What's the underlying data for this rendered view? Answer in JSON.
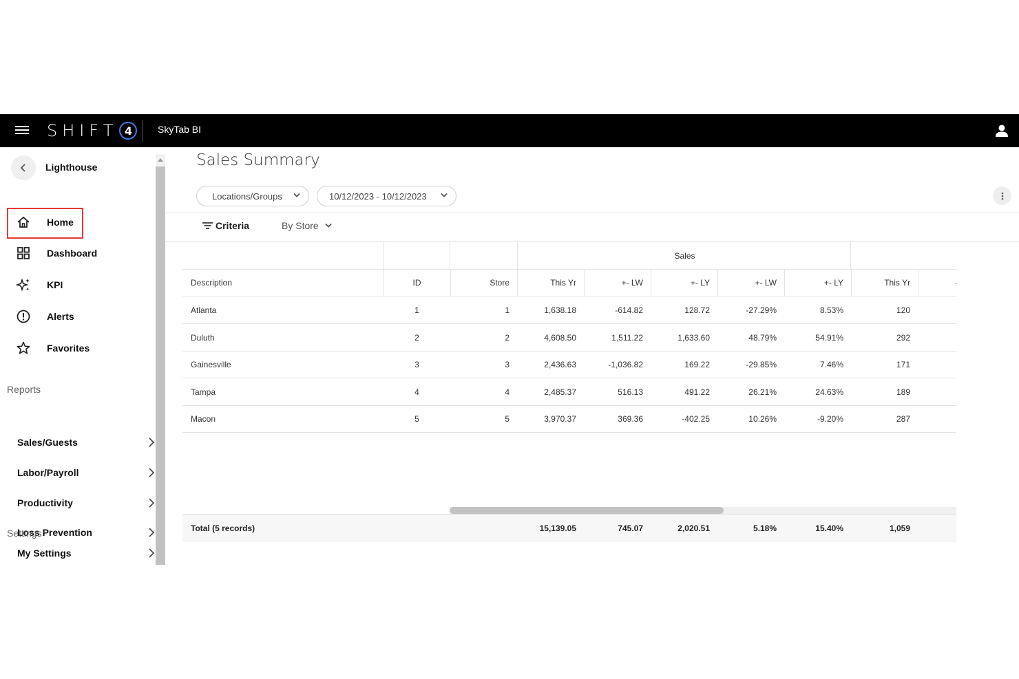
{
  "topbar": {
    "brand_text": "SHIFT",
    "brand_badge": "4",
    "app_name": "SkyTab BI"
  },
  "sidebar": {
    "org_name": "Lighthouse",
    "nav": [
      {
        "label": "Home",
        "icon": "home-icon"
      },
      {
        "label": "Dashboard",
        "icon": "grid-icon"
      },
      {
        "label": "KPI",
        "icon": "sparkle-icon"
      },
      {
        "label": "Alerts",
        "icon": "alert-circle-icon"
      },
      {
        "label": "Favorites",
        "icon": "star-icon"
      }
    ],
    "reports_label": "Reports",
    "reports": [
      {
        "label": "Sales/Guests"
      },
      {
        "label": "Labor/Payroll"
      },
      {
        "label": "Productivity"
      },
      {
        "label": "Loss Prevention"
      }
    ],
    "settings_label": "Settings",
    "settings": [
      {
        "label": "My Settings"
      }
    ]
  },
  "main": {
    "title": "Sales Summary",
    "filters": {
      "locations": "Locations/Groups",
      "date_range": "10/12/2023 - 10/12/2023"
    },
    "criteria_label": "Criteria",
    "group_by": "By Store"
  },
  "table": {
    "group_header": "Sales",
    "columns": [
      "Description",
      "ID",
      "Store",
      "This Yr",
      "+- LW",
      "+- LY",
      "+- LW",
      "+- LY",
      "This Yr",
      "-"
    ],
    "rows": [
      {
        "description": "Atlanta",
        "id": "1",
        "store": "1",
        "this_yr": "1,638.18",
        "lw": "-614.82",
        "ly": "128.72",
        "lw_pct": "-27.29%",
        "ly_pct": "8.53%",
        "this_yr2": "120"
      },
      {
        "description": "Duluth",
        "id": "2",
        "store": "2",
        "this_yr": "4,608.50",
        "lw": "1,511.22",
        "ly": "1,633.60",
        "lw_pct": "48.79%",
        "ly_pct": "54.91%",
        "this_yr2": "292"
      },
      {
        "description": "Gainesville",
        "id": "3",
        "store": "3",
        "this_yr": "2,436.63",
        "lw": "-1,036.82",
        "ly": "169.22",
        "lw_pct": "-29.85%",
        "ly_pct": "7.46%",
        "this_yr2": "171"
      },
      {
        "description": "Tampa",
        "id": "4",
        "store": "4",
        "this_yr": "2,485.37",
        "lw": "516.13",
        "ly": "491.22",
        "lw_pct": "26.21%",
        "ly_pct": "24.63%",
        "this_yr2": "189"
      },
      {
        "description": "Macon",
        "id": "5",
        "store": "5",
        "this_yr": "3,970.37",
        "lw": "369.36",
        "ly": "-402.25",
        "lw_pct": "10.26%",
        "ly_pct": "-9.20%",
        "this_yr2": "287"
      }
    ],
    "total": {
      "label": "Total (5 records)",
      "this_yr": "15,139.05",
      "lw": "745.07",
      "ly": "2,020.51",
      "lw_pct": "5.18%",
      "ly_pct": "15.40%",
      "this_yr2": "1,059"
    }
  },
  "colors": {
    "topbar_bg": "#000000",
    "brand_accent": "#3d7bd9",
    "highlight_border": "#e53935"
  }
}
